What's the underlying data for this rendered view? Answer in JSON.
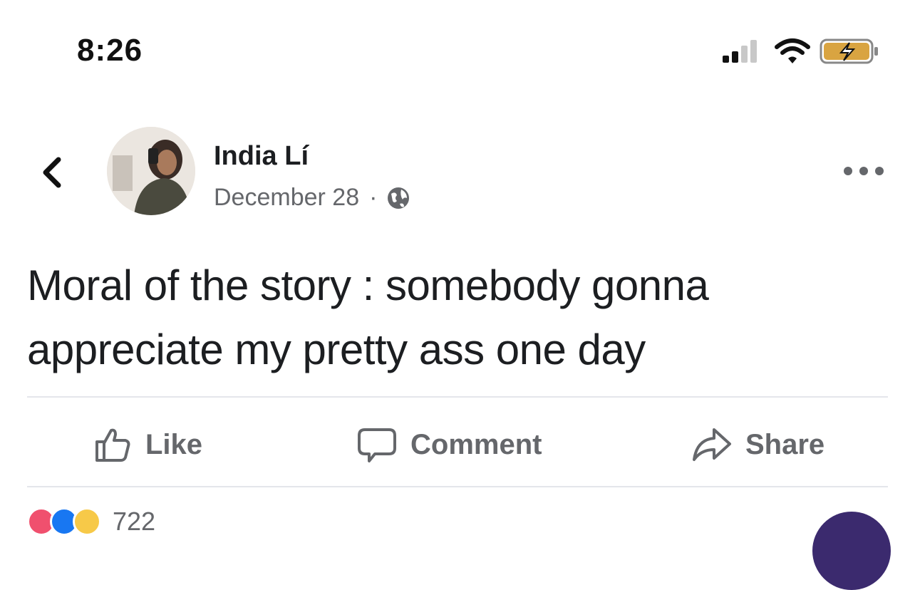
{
  "status_bar": {
    "time": "8:26",
    "icons": [
      "cellular-signal-icon",
      "wifi-icon",
      "battery-charging-icon"
    ]
  },
  "post": {
    "author": "India Lí",
    "date": "December 28",
    "separator": "·",
    "privacy_icon": "globe-icon",
    "text_lines": [
      "Moral of the story : somebody gonna",
      "appreciate my pretty ass one day"
    ]
  },
  "actions": {
    "like_label": "Like",
    "comment_label": "Comment",
    "share_label": "Share"
  },
  "reactions": {
    "icons": [
      "love-reaction-icon",
      "like-reaction-icon",
      "haha-reaction-icon"
    ],
    "count": "722"
  },
  "colors": {
    "secondary_text": "#65676b",
    "divider": "#e4e6eb",
    "primary_text": "#1c1e21"
  }
}
